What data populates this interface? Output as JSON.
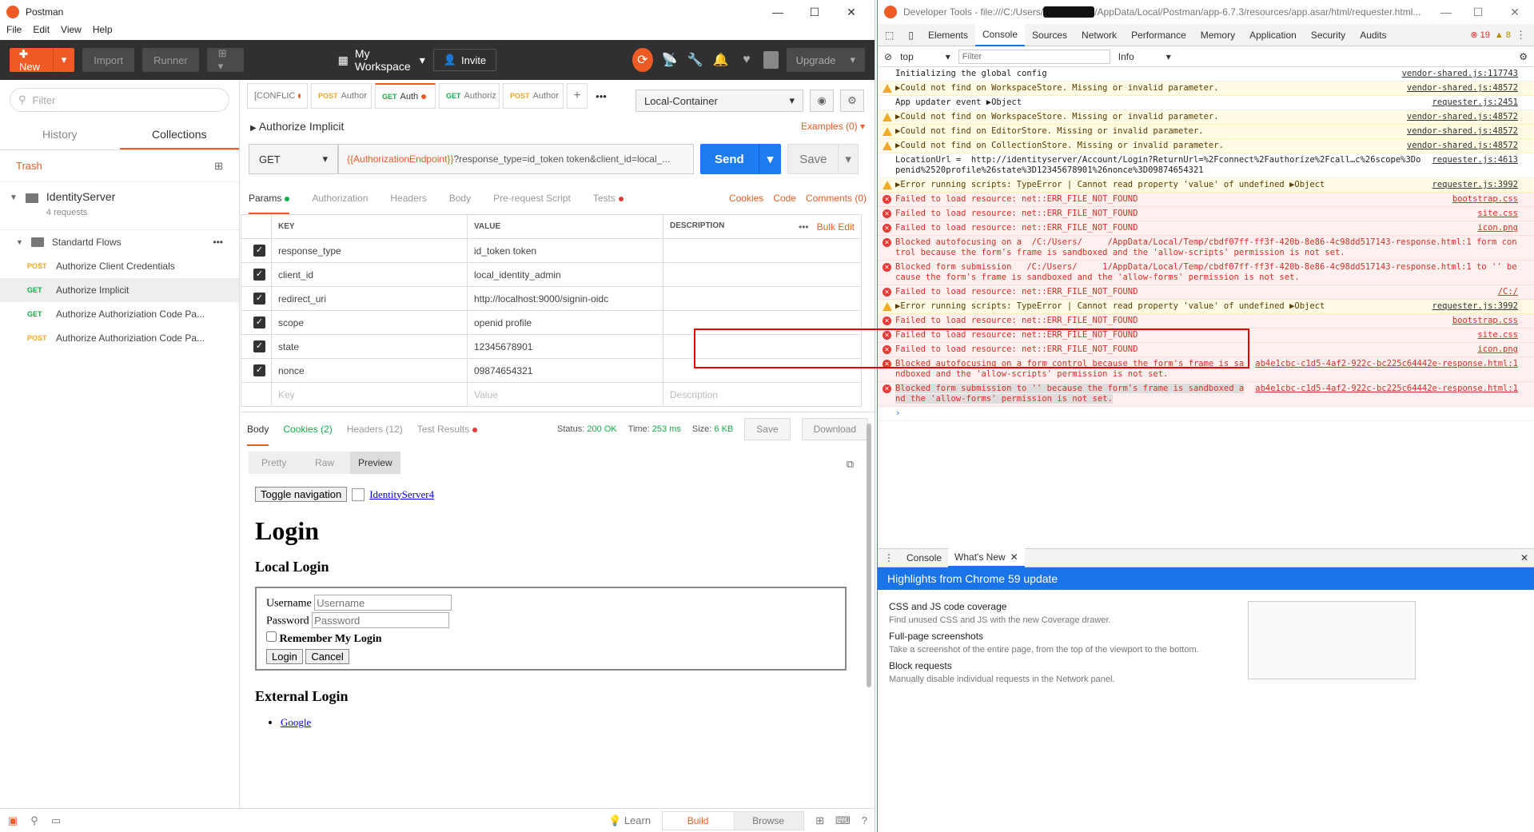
{
  "postman": {
    "title": "Postman",
    "menu": [
      "File",
      "Edit",
      "View",
      "Help"
    ],
    "toolbar": {
      "new": "New",
      "import": "Import",
      "runner": "Runner",
      "workspace": "My Workspace",
      "invite": "Invite",
      "upgrade": "Upgrade"
    },
    "sidebar": {
      "filter_placeholder": "Filter",
      "tabs": [
        "History",
        "Collections"
      ],
      "trash": "Trash",
      "collection": {
        "name": "IdentityServer",
        "count": "4 requests"
      },
      "folder": "Standartd Flows",
      "requests": [
        {
          "method": "POST",
          "name": "Authorize Client Credentials"
        },
        {
          "method": "GET",
          "name": "Authorize Implicit"
        },
        {
          "method": "GET",
          "name": "Authorize Authoriziation Code Pa..."
        },
        {
          "method": "POST",
          "name": "Authorize Authoriziation Code Pa..."
        }
      ]
    },
    "tabs": [
      {
        "method": "",
        "label": "[CONFLIC"
      },
      {
        "method": "POST",
        "label": "Author"
      },
      {
        "method": "GET",
        "label": "Auth"
      },
      {
        "method": "GET",
        "label": "Authoriz"
      },
      {
        "method": "POST",
        "label": "Author"
      }
    ],
    "environment": "Local-Container",
    "request": {
      "title": "Authorize Implicit",
      "examples": "Examples (0)",
      "method": "GET",
      "url_var": "{{AuthorizationEndpoint}}",
      "url_rest": "?response_type=id_token token&client_id=local_...",
      "send": "Send",
      "save": "Save"
    },
    "subtabs": {
      "params": "Params",
      "authorization": "Authorization",
      "headers": "Headers",
      "body": "Body",
      "prerequest": "Pre-request Script",
      "tests": "Tests",
      "cookies": "Cookies",
      "code": "Code",
      "comments": "Comments (0)"
    },
    "params_header": {
      "key": "KEY",
      "value": "VALUE",
      "description": "DESCRIPTION",
      "bulk": "Bulk Edit"
    },
    "params": [
      {
        "key": "response_type",
        "value": "id_token token"
      },
      {
        "key": "client_id",
        "value": "local_identity_admin"
      },
      {
        "key": "redirect_uri",
        "value": "http://localhost:9000/signin-oidc"
      },
      {
        "key": "scope",
        "value": "openid profile"
      },
      {
        "key": "state",
        "value": "12345678901"
      },
      {
        "key": "nonce",
        "value": "09874654321"
      }
    ],
    "params_placeholder": {
      "key": "Key",
      "value": "Value",
      "description": "Description"
    },
    "response": {
      "tabs": [
        "Body",
        "Cookies (2)",
        "Headers (12)",
        "Test Results"
      ],
      "status_label": "Status:",
      "status": "200 OK",
      "time_label": "Time:",
      "time": "253 ms",
      "size_label": "Size:",
      "size": "6 KB",
      "save": "Save",
      "download": "Download",
      "views": [
        "Pretty",
        "Raw",
        "Preview"
      ]
    },
    "preview": {
      "toggle": "Toggle navigation",
      "brand": "IdentityServer4",
      "h1": "Login",
      "local": "Local Login",
      "username_label": "Username",
      "username_ph": "Username",
      "password_label": "Password",
      "password_ph": "Password",
      "remember": "Remember My Login",
      "login": "Login",
      "cancel": "Cancel",
      "external": "External Login",
      "google": "Google"
    },
    "status_bar": {
      "learn": "Learn",
      "build": "Build",
      "browse": "Browse"
    }
  },
  "devtools": {
    "title": "Developer Tools - file:///C:/Users/",
    "title_rest": "/AppData/Local/Postman/app-6.7.3/resources/app.asar/html/requester.html...",
    "tabs": [
      "Elements",
      "Console",
      "Sources",
      "Network",
      "Performance",
      "Memory",
      "Application",
      "Security",
      "Audits"
    ],
    "errors": "19",
    "warnings": "8",
    "context": "top",
    "filter_ph": "Filter",
    "level": "Info",
    "console": [
      {
        "type": "info",
        "msg": "Initializing the global config",
        "src": "vendor-shared.js:117743"
      },
      {
        "type": "warn",
        "msg": "▶Could not find on WorkspaceStore. Missing or invalid parameter.",
        "src": "vendor-shared.js:48572"
      },
      {
        "type": "info",
        "msg": "App updater event ▶Object",
        "src": "requester.js:2451"
      },
      {
        "type": "warn",
        "msg": "▶Could not find on WorkspaceStore. Missing or invalid parameter.",
        "src": "vendor-shared.js:48572"
      },
      {
        "type": "warn",
        "msg": "▶Could not find on EditorStore. Missing or invalid parameter.",
        "src": "vendor-shared.js:48572"
      },
      {
        "type": "warn",
        "msg": "▶Could not find on CollectionStore. Missing or invalid parameter.",
        "src": "vendor-shared.js:48572"
      },
      {
        "type": "info",
        "msg": "LocationUrl =  http://identityserver/Account/Login?ReturnUrl=%2Fconnect%2Fauthorize%2Fcall…c%26scope%3Dopenid%2520profile%26state%3D12345678901%26nonce%3D09874654321",
        "src": "requester.js:4613"
      },
      {
        "type": "warn",
        "msg": "▶Error running scripts: TypeError | Cannot read property 'value' of undefined ▶Object",
        "src": "requester.js:3992"
      },
      {
        "type": "err",
        "msg": "Failed to load resource: net::ERR_FILE_NOT_FOUND",
        "src": "bootstrap.css"
      },
      {
        "type": "err",
        "msg": "Failed to load resource: net::ERR_FILE_NOT_FOUND",
        "src": "site.css"
      },
      {
        "type": "err",
        "msg": "Failed to load resource: net::ERR_FILE_NOT_FOUND",
        "src": "icon.png"
      },
      {
        "type": "err",
        "msg": "Blocked autofocusing on a  /C:/Users/     /AppData/Local/Temp/cbdf07ff-ff3f-420b-8e86-4c98dd517143-response.html:1 form control because the form's frame is sandboxed and the 'allow-scripts' permission is not set.",
        "src": ""
      },
      {
        "type": "err",
        "msg": "Blocked form submission   /C:/Users/     1/AppData/Local/Temp/cbdf07ff-ff3f-420b-8e86-4c98dd517143-response.html:1 to '' because the form's frame is sandboxed and the 'allow-forms' permission is not set.",
        "src": ""
      },
      {
        "type": "err",
        "msg": "Failed to load resource: net::ERR_FILE_NOT_FOUND",
        "src": "/C:/"
      },
      {
        "type": "warn",
        "msg": "▶Error running scripts: TypeError | Cannot read property 'value' of undefined ▶Object",
        "src": "requester.js:3992"
      },
      {
        "type": "err",
        "msg": "Failed to load resource: net::ERR_FILE_NOT_FOUND",
        "src": "bootstrap.css"
      },
      {
        "type": "err",
        "msg": "Failed to load resource: net::ERR_FILE_NOT_FOUND",
        "src": "site.css"
      },
      {
        "type": "err",
        "msg": "Failed to load resource: net::ERR_FILE_NOT_FOUND",
        "src": "icon.png"
      },
      {
        "type": "err",
        "msg": "Blocked autofocusing on a form control because the form's frame is sandboxed and the 'allow-scripts' permission is not set.",
        "src": "ab4e1cbc-c1d5-4af2-922c-bc225c64442e-response.html:1"
      },
      {
        "type": "err sel",
        "msg": "Blocked form submission to '' because the form's frame is sandboxed and the 'allow-forms' permission is not set.",
        "src": "ab4e1cbc-c1d5-4af2-922c-bc225c64442e-response.html:1"
      }
    ],
    "drawer": {
      "console": "Console",
      "whatsnew": "What's New"
    },
    "banner": "Highlights from Chrome 59 update",
    "whatsnew": [
      {
        "h": "CSS and JS code coverage",
        "d": "Find unused CSS and JS with the new Coverage drawer."
      },
      {
        "h": "Full-page screenshots",
        "d": "Take a screenshot of the entire page, from the top of the viewport to the bottom."
      },
      {
        "h": "Block requests",
        "d": "Manually disable individual requests in the Network panel."
      }
    ]
  }
}
